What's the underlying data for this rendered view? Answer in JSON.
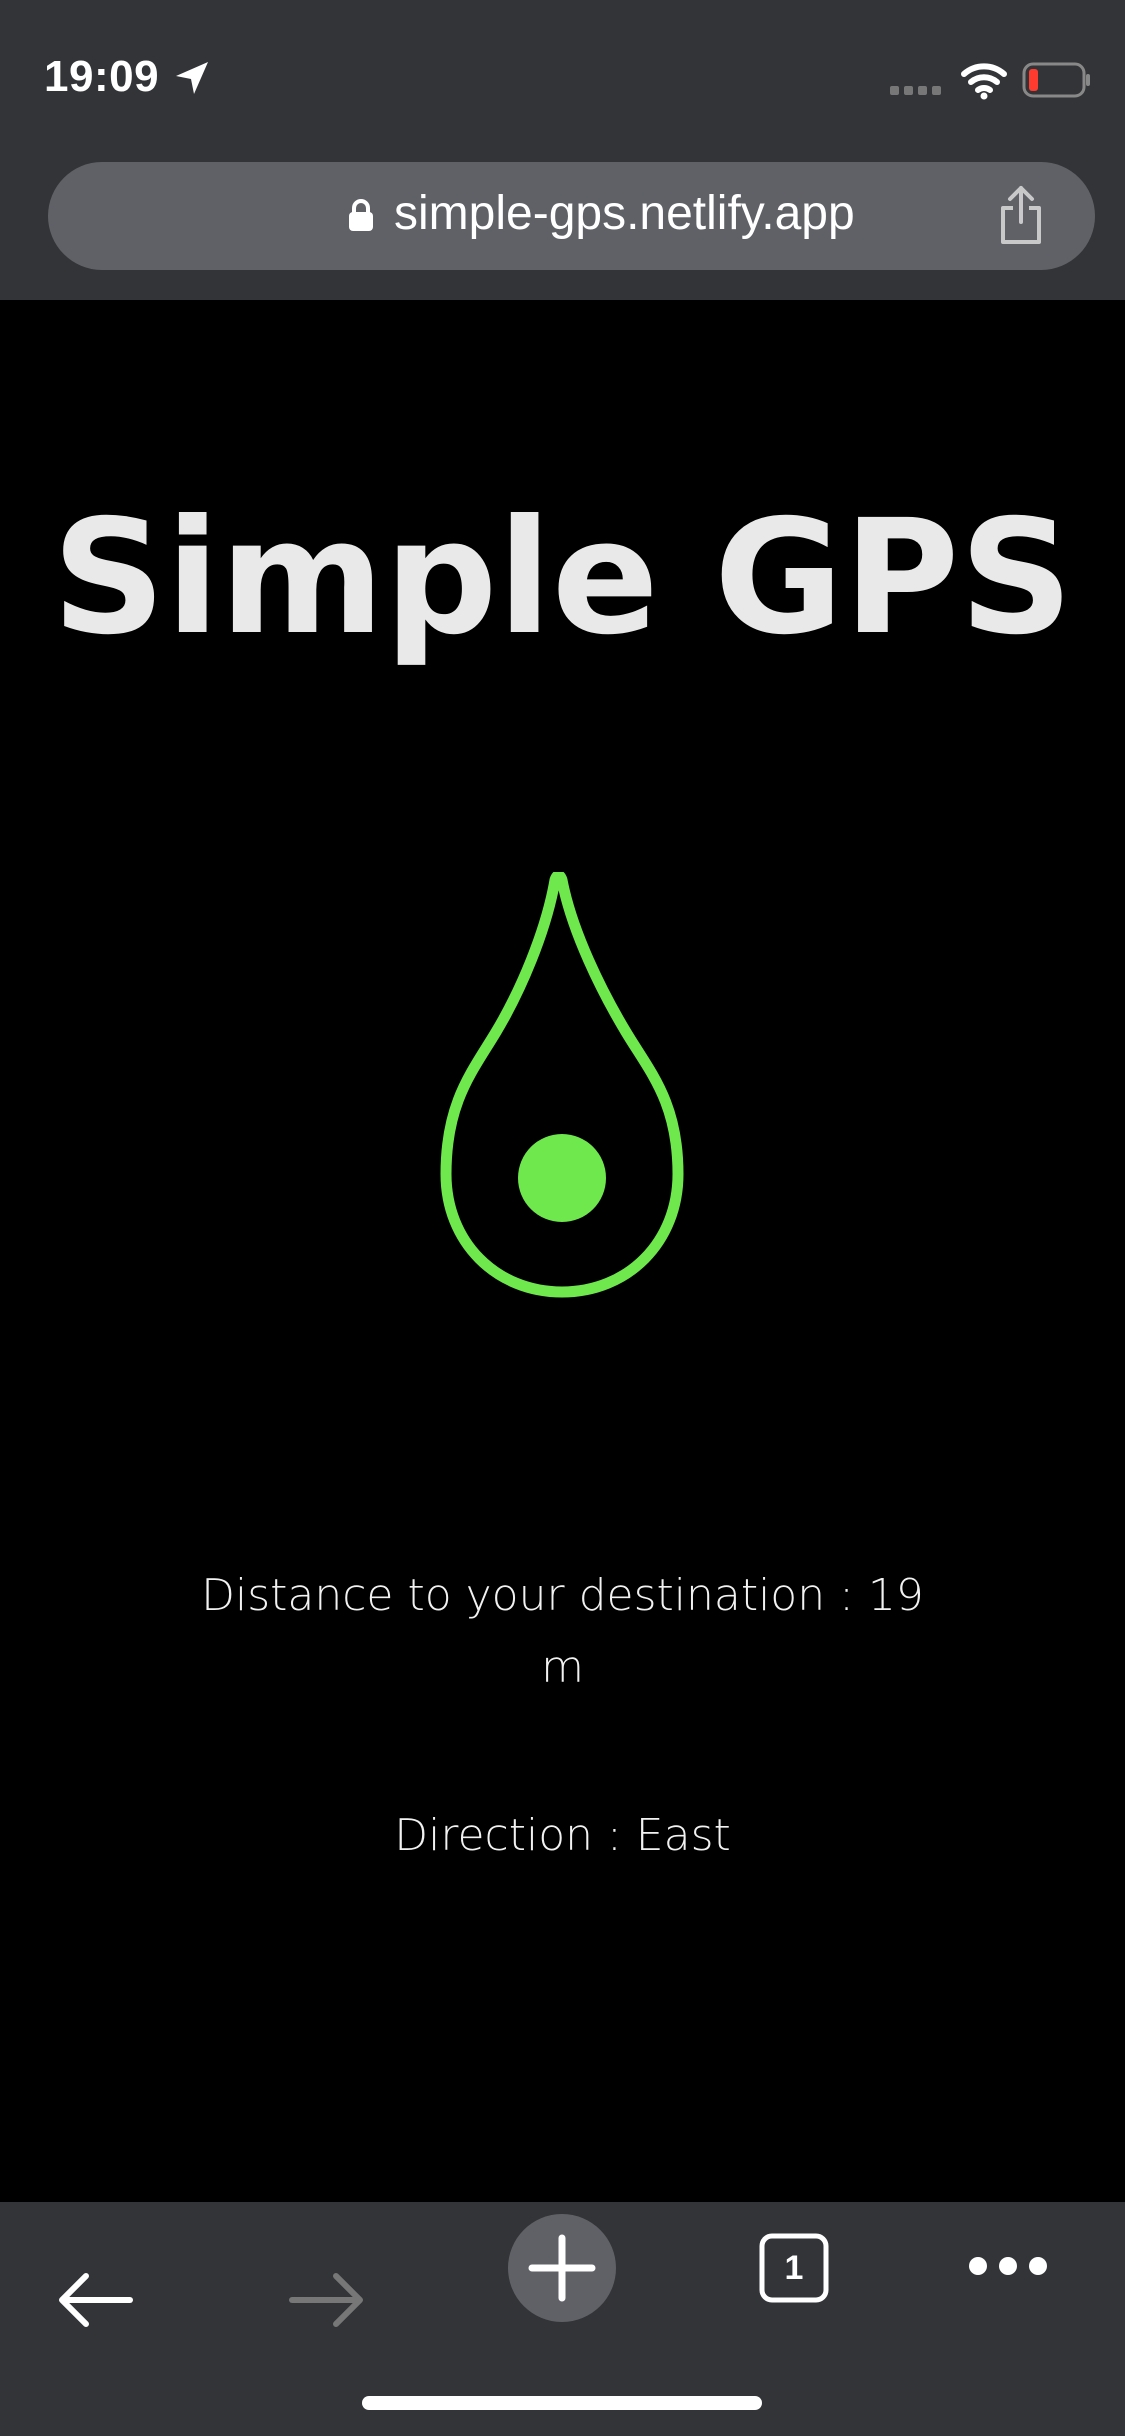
{
  "status_bar": {
    "time": "19:09"
  },
  "browser": {
    "url": "simple-gps.netlify.app",
    "tab_count": "1"
  },
  "app": {
    "title": "Simple GPS",
    "distance_text": "Distance to your destination : 19 m",
    "direction_text": "Direction : East"
  },
  "colors": {
    "accent": "#6ee84c",
    "background": "#000000",
    "chrome": "#333437"
  },
  "icons": {
    "status": [
      "location-arrow-icon",
      "signal-icon",
      "wifi-icon",
      "battery-icon"
    ],
    "urlbar": [
      "lock-icon",
      "share-icon"
    ],
    "toolbar": [
      "back-arrow-icon",
      "forward-arrow-icon",
      "plus-icon",
      "tabs-icon",
      "more-icon"
    ],
    "main": [
      "location-pin-icon"
    ]
  }
}
